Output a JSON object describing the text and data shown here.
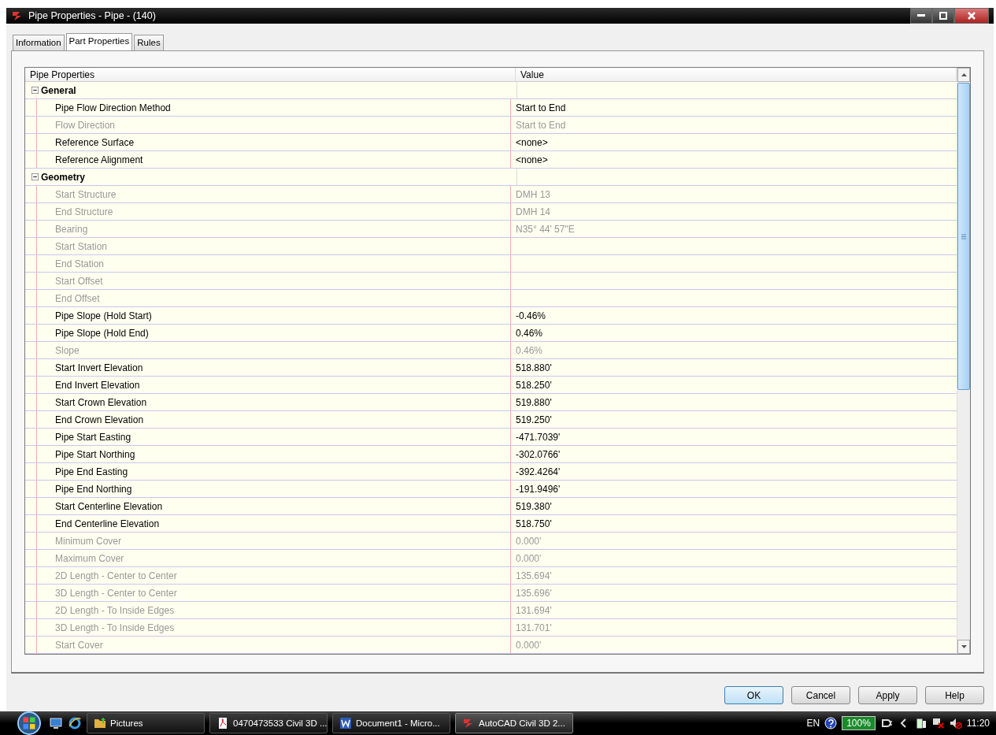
{
  "window": {
    "title": "Pipe Properties - Pipe - (140)"
  },
  "tabs": [
    {
      "label": "Information",
      "selected": false
    },
    {
      "label": "Part Properties",
      "selected": true
    },
    {
      "label": "Rules",
      "selected": false
    }
  ],
  "grid": {
    "columns": [
      "Pipe Properties",
      "Value"
    ],
    "categories": [
      {
        "label": "General",
        "expanded": true,
        "children": [
          {
            "name": "Pipe Flow Direction Method",
            "value": "Start to End",
            "disabled": false
          },
          {
            "name": "Flow Direction",
            "value": "Start to End",
            "disabled": true
          },
          {
            "name": "Reference Surface",
            "value": "<none>",
            "disabled": false
          },
          {
            "name": "Reference Alignment",
            "value": "<none>",
            "disabled": false
          }
        ]
      },
      {
        "label": "Geometry",
        "expanded": true,
        "children": [
          {
            "name": "Start Structure",
            "value": "DMH 13",
            "disabled": true
          },
          {
            "name": "End Structure",
            "value": "DMH 14",
            "disabled": true
          },
          {
            "name": "Bearing",
            "value": "N35° 44' 57\"E",
            "disabled": true
          },
          {
            "name": "Start Station",
            "disabled": true
          },
          {
            "name": "End Station",
            "disabled": true
          },
          {
            "name": "Start Offset",
            "disabled": true
          },
          {
            "name": "End Offset",
            "disabled": true
          },
          {
            "name": "Pipe Slope (Hold Start)",
            "value": "-0.46%",
            "disabled": false
          },
          {
            "name": "Pipe Slope (Hold End)",
            "value": "0.46%",
            "disabled": false
          },
          {
            "name": "Slope",
            "value": "0.46%",
            "disabled": true
          },
          {
            "name": "Start Invert Elevation",
            "value": "518.880'",
            "disabled": false
          },
          {
            "name": "End Invert Elevation",
            "value": "518.250'",
            "disabled": false
          },
          {
            "name": "Start Crown Elevation",
            "value": "519.880'",
            "disabled": false
          },
          {
            "name": "End Crown Elevation",
            "value": "519.250'",
            "disabled": false
          },
          {
            "name": "Pipe Start Easting",
            "value": "-471.7039'",
            "disabled": false
          },
          {
            "name": "Pipe Start Northing",
            "value": "-302.0766'",
            "disabled": false
          },
          {
            "name": "Pipe End Easting",
            "value": "-392.4264'",
            "disabled": false
          },
          {
            "name": "Pipe End Northing",
            "value": "-191.9496'",
            "disabled": false
          },
          {
            "name": "Start Centerline Elevation",
            "value": "519.380'",
            "disabled": false
          },
          {
            "name": "End Centerline Elevation",
            "value": "518.750'",
            "disabled": false
          },
          {
            "name": "Minimum Cover",
            "value": "0.000'",
            "disabled": true
          },
          {
            "name": "Maximum Cover",
            "value": "0.000'",
            "disabled": true
          },
          {
            "name": "2D Length - Center to Center",
            "value": "135.694'",
            "disabled": true
          },
          {
            "name": "3D Length - Center to Center",
            "value": "135.696'",
            "disabled": true
          },
          {
            "name": "2D Length - To Inside Edges",
            "value": "131.694'",
            "disabled": true
          },
          {
            "name": "3D Length - To Inside Edges",
            "value": "131.701'",
            "disabled": true
          },
          {
            "name": "Start Cover",
            "value": "0.000'",
            "disabled": true
          }
        ]
      }
    ]
  },
  "buttons": [
    {
      "label": "OK",
      "default": true
    },
    {
      "label": "Cancel",
      "default": false
    },
    {
      "label": "Apply",
      "default": false
    },
    {
      "label": "Help",
      "default": false
    }
  ],
  "taskbar": {
    "tasks": [
      {
        "label": "Pictures",
        "kind": "folder",
        "selected": false
      },
      {
        "label": "0470473533 Civil 3D ...",
        "kind": "pdf",
        "selected": false
      },
      {
        "label": "Document1 - Micro...",
        "kind": "word",
        "selected": false
      },
      {
        "label": "AutoCAD Civil 3D 2...",
        "kind": "app",
        "selected": true
      }
    ],
    "tray": {
      "language": "EN",
      "battery": "100%",
      "clock": "11:20"
    }
  }
}
